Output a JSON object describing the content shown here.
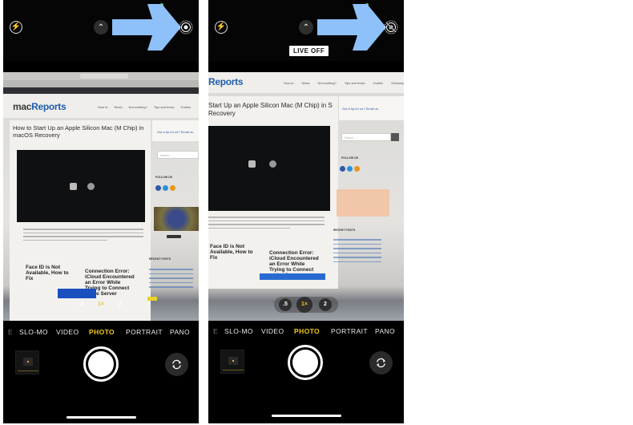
{
  "panels": [
    {
      "id": "left",
      "live_photo_state": "on",
      "live_off_badge": null,
      "webpage": {
        "logo_prefix": "mac",
        "logo_suffix": "Reports",
        "nav": [
          "How to",
          "News",
          "Not working?",
          "Tips and tricks",
          "Guides"
        ],
        "article_title": "How to Start Up an Apple Silicon Mac (M Chip) in macOS Recovery",
        "tip_link": "Got a tip for us? Email us.",
        "search_placeholder": "Search ...",
        "follow_label": "FOLLOW US",
        "recent_label": "RECENT POSTS",
        "card1_title": "Face ID is Not Available, How to Fix",
        "card2_title": "Connection Error: iCloud Encountered an Error While Trying to Connect to the Server"
      }
    },
    {
      "id": "right",
      "live_photo_state": "off",
      "live_off_badge": "LIVE OFF",
      "webpage": {
        "logo_suffix": "Reports",
        "nav": [
          "How to",
          "News",
          "Not working?",
          "Tips and tricks",
          "Guides",
          "Glossary"
        ],
        "article_title": "Start Up an Apple Silicon Mac (M Chip) in S Recovery",
        "tip_link": "Got a tip for us? Email us.",
        "search_placeholder": "Search ...",
        "follow_label": "FOLLOW US",
        "recent_label": "RECENT POSTS",
        "card1_title": "Face ID is Not Available, How to Fix",
        "card2_title": "Connection Error: iCloud Encountered an Error While Trying to Connect to the Server"
      }
    }
  ],
  "camera": {
    "zoom_levels": [
      ".5",
      "1×",
      "2"
    ],
    "active_zoom": "1×",
    "modes": [
      "SLO-MO",
      "VIDEO",
      "PHOTO",
      "PORTRAIT",
      "PANO"
    ],
    "active_mode": "PHOTO",
    "colors": {
      "active_accent": "#f3c823",
      "annotation_arrow": "#8ec0fa"
    }
  },
  "icons": {
    "flash": "flash-icon",
    "chevron": "chevron-up-icon",
    "live_on": "live-photo-icon",
    "live_off": "live-photo-off-icon",
    "flip": "camera-flip-icon"
  }
}
